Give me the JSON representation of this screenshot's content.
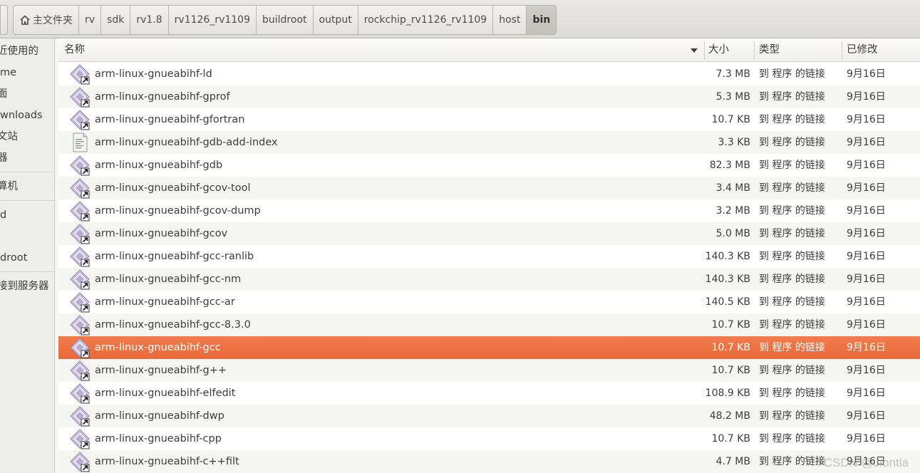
{
  "breadcrumb": {
    "home_label": "主文件夹",
    "segments": [
      "rv",
      "sdk",
      "rv1.8",
      "rv1126_rv1109",
      "buildroot",
      "output",
      "rockchip_rv1126_rv1109",
      "host",
      "bin"
    ]
  },
  "sidebar": {
    "items": [
      "近使用的",
      "me",
      "面",
      "wnloads",
      "文站",
      "器",
      "算机",
      "d",
      "",
      "droot",
      "接到服务器"
    ]
  },
  "columns": {
    "name": "名称",
    "size": "大小",
    "type": "类型",
    "modified": "已修改"
  },
  "files": [
    {
      "name": "arm-linux-gnueabihf-ld",
      "size": "7.3 MB",
      "type": "到 程序 的链接",
      "modified": "9月16日",
      "icon": "executable-link-icon"
    },
    {
      "name": "arm-linux-gnueabihf-gprof",
      "size": "5.3 MB",
      "type": "到 程序 的链接",
      "modified": "9月16日",
      "icon": "executable-link-icon"
    },
    {
      "name": "arm-linux-gnueabihf-gfortran",
      "size": "10.7 KB",
      "type": "到 程序 的链接",
      "modified": "9月16日",
      "icon": "executable-link-icon"
    },
    {
      "name": "arm-linux-gnueabihf-gdb-add-index",
      "size": "3.3 KB",
      "type": "到 程序 的链接",
      "modified": "9月16日",
      "icon": "script-link-icon"
    },
    {
      "name": "arm-linux-gnueabihf-gdb",
      "size": "82.3 MB",
      "type": "到 程序 的链接",
      "modified": "9月16日",
      "icon": "executable-link-icon"
    },
    {
      "name": "arm-linux-gnueabihf-gcov-tool",
      "size": "3.4 MB",
      "type": "到 程序 的链接",
      "modified": "9月16日",
      "icon": "executable-link-icon"
    },
    {
      "name": "arm-linux-gnueabihf-gcov-dump",
      "size": "3.2 MB",
      "type": "到 程序 的链接",
      "modified": "9月16日",
      "icon": "executable-link-icon"
    },
    {
      "name": "arm-linux-gnueabihf-gcov",
      "size": "5.0 MB",
      "type": "到 程序 的链接",
      "modified": "9月16日",
      "icon": "executable-link-icon"
    },
    {
      "name": "arm-linux-gnueabihf-gcc-ranlib",
      "size": "140.3 KB",
      "type": "到 程序 的链接",
      "modified": "9月16日",
      "icon": "executable-link-icon"
    },
    {
      "name": "arm-linux-gnueabihf-gcc-nm",
      "size": "140.3 KB",
      "type": "到 程序 的链接",
      "modified": "9月16日",
      "icon": "executable-link-icon"
    },
    {
      "name": "arm-linux-gnueabihf-gcc-ar",
      "size": "140.5 KB",
      "type": "到 程序 的链接",
      "modified": "9月16日",
      "icon": "executable-link-icon"
    },
    {
      "name": "arm-linux-gnueabihf-gcc-8.3.0",
      "size": "10.7 KB",
      "type": "到 程序 的链接",
      "modified": "9月16日",
      "icon": "executable-link-icon"
    },
    {
      "name": "arm-linux-gnueabihf-gcc",
      "size": "10.7 KB",
      "type": "到 程序 的链接",
      "modified": "9月16日",
      "icon": "executable-link-icon",
      "selected": true
    },
    {
      "name": "arm-linux-gnueabihf-g++",
      "size": "10.7 KB",
      "type": "到 程序 的链接",
      "modified": "9月16日",
      "icon": "executable-link-icon"
    },
    {
      "name": "arm-linux-gnueabihf-elfedit",
      "size": "108.9 KB",
      "type": "到 程序 的链接",
      "modified": "9月16日",
      "icon": "executable-link-icon"
    },
    {
      "name": "arm-linux-gnueabihf-dwp",
      "size": "48.2 MB",
      "type": "到 程序 的链接",
      "modified": "9月16日",
      "icon": "executable-link-icon"
    },
    {
      "name": "arm-linux-gnueabihf-cpp",
      "size": "10.7 KB",
      "type": "到 程序 的链接",
      "modified": "9月16日",
      "icon": "executable-link-icon"
    },
    {
      "name": "arm-linux-gnueabihf-c++filt",
      "size": "4.7 MB",
      "type": "到 程序 的链接",
      "modified": "9月16日",
      "icon": "executable-link-icon"
    }
  ],
  "watermark": "CSDN @Jiontla",
  "colors": {
    "selection": "#ef7441",
    "header_bg": "#dcdbd7",
    "sidebar_bg": "#ededeb"
  }
}
